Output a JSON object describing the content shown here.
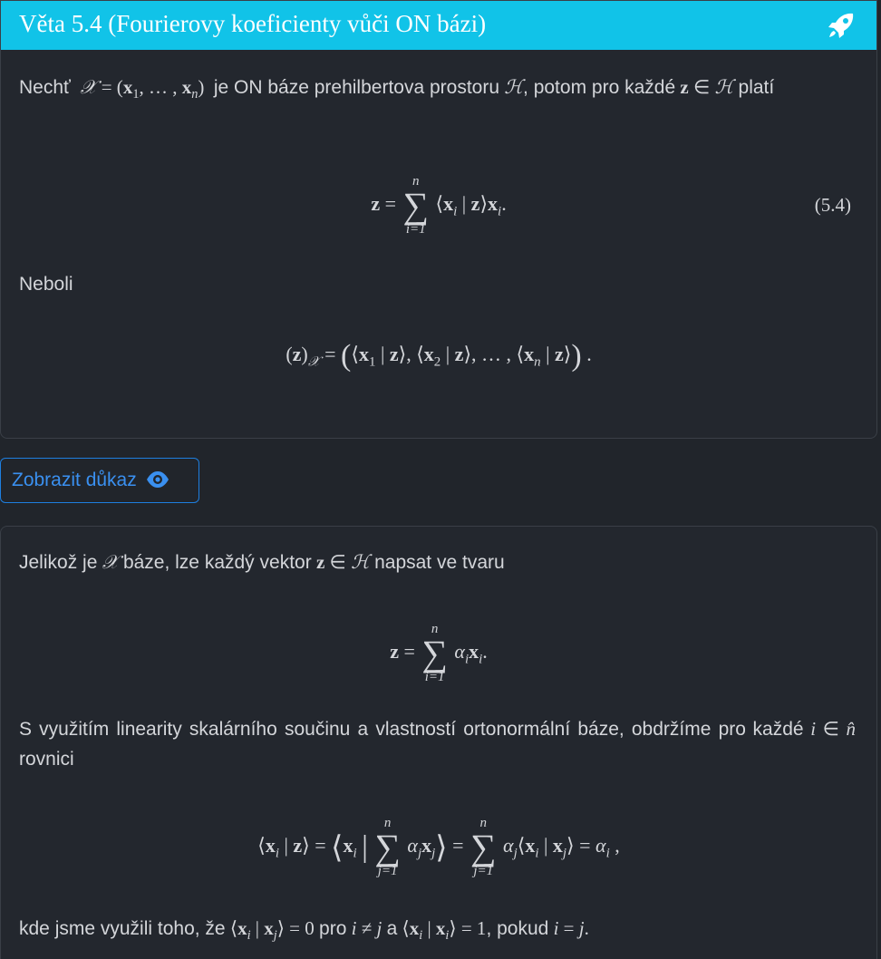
{
  "theorem": {
    "title": "Věta 5.4 (Fourierovy koeficienty vůči ON bázi)",
    "icon": "rocket-icon",
    "header_color": "#11c3e8",
    "intro_a": "Nechť",
    "intro_b": "je ON báze prehilbertova prostoru",
    "intro_c": ", potom pro každé",
    "intro_d": "platí",
    "equation_number": "(5.4)",
    "neboli": "Neboli"
  },
  "proof_button": {
    "label": "Zobrazit důkaz",
    "icon": "eye-icon",
    "color": "#1e7fe0"
  },
  "proof": {
    "p1_a": "Jelikož je",
    "p1_b": "báze, lze každý vektor",
    "p1_c": "napsat ve tvaru",
    "p2_a": "S využitím linearity skalárního součinu a vlastností ortonormální báze, obdržíme pro",
    "p2_b": "každé",
    "p2_c": "rovnici",
    "p3_a": "kde jsme využili toho, že",
    "p3_b": "pro",
    "p3_c": "a",
    "p3_d": ", pokud"
  }
}
